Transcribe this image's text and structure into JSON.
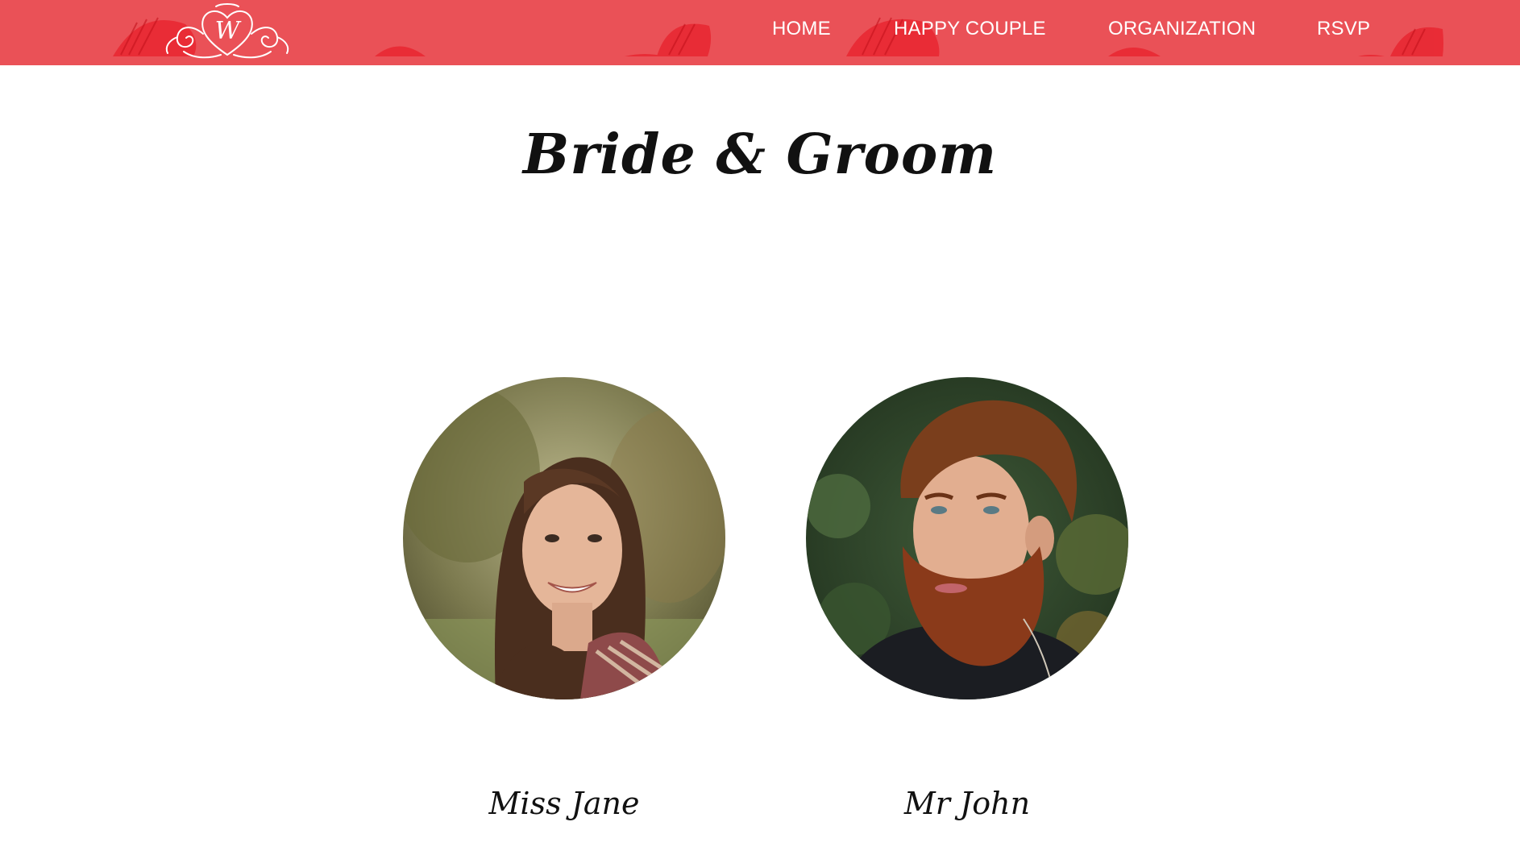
{
  "header": {
    "logo_icon": "wedding-monogram-icon",
    "background_color": "#ea5157",
    "nav": {
      "home": "HOME",
      "happy_couple": "HAPPY COUPLE",
      "organization": "ORGANIZATION",
      "rsvp": "RSVP"
    }
  },
  "main": {
    "title": "Bride & Groom",
    "couple": [
      {
        "name": "Miss Jane"
      },
      {
        "name": "Mr John"
      }
    ]
  }
}
